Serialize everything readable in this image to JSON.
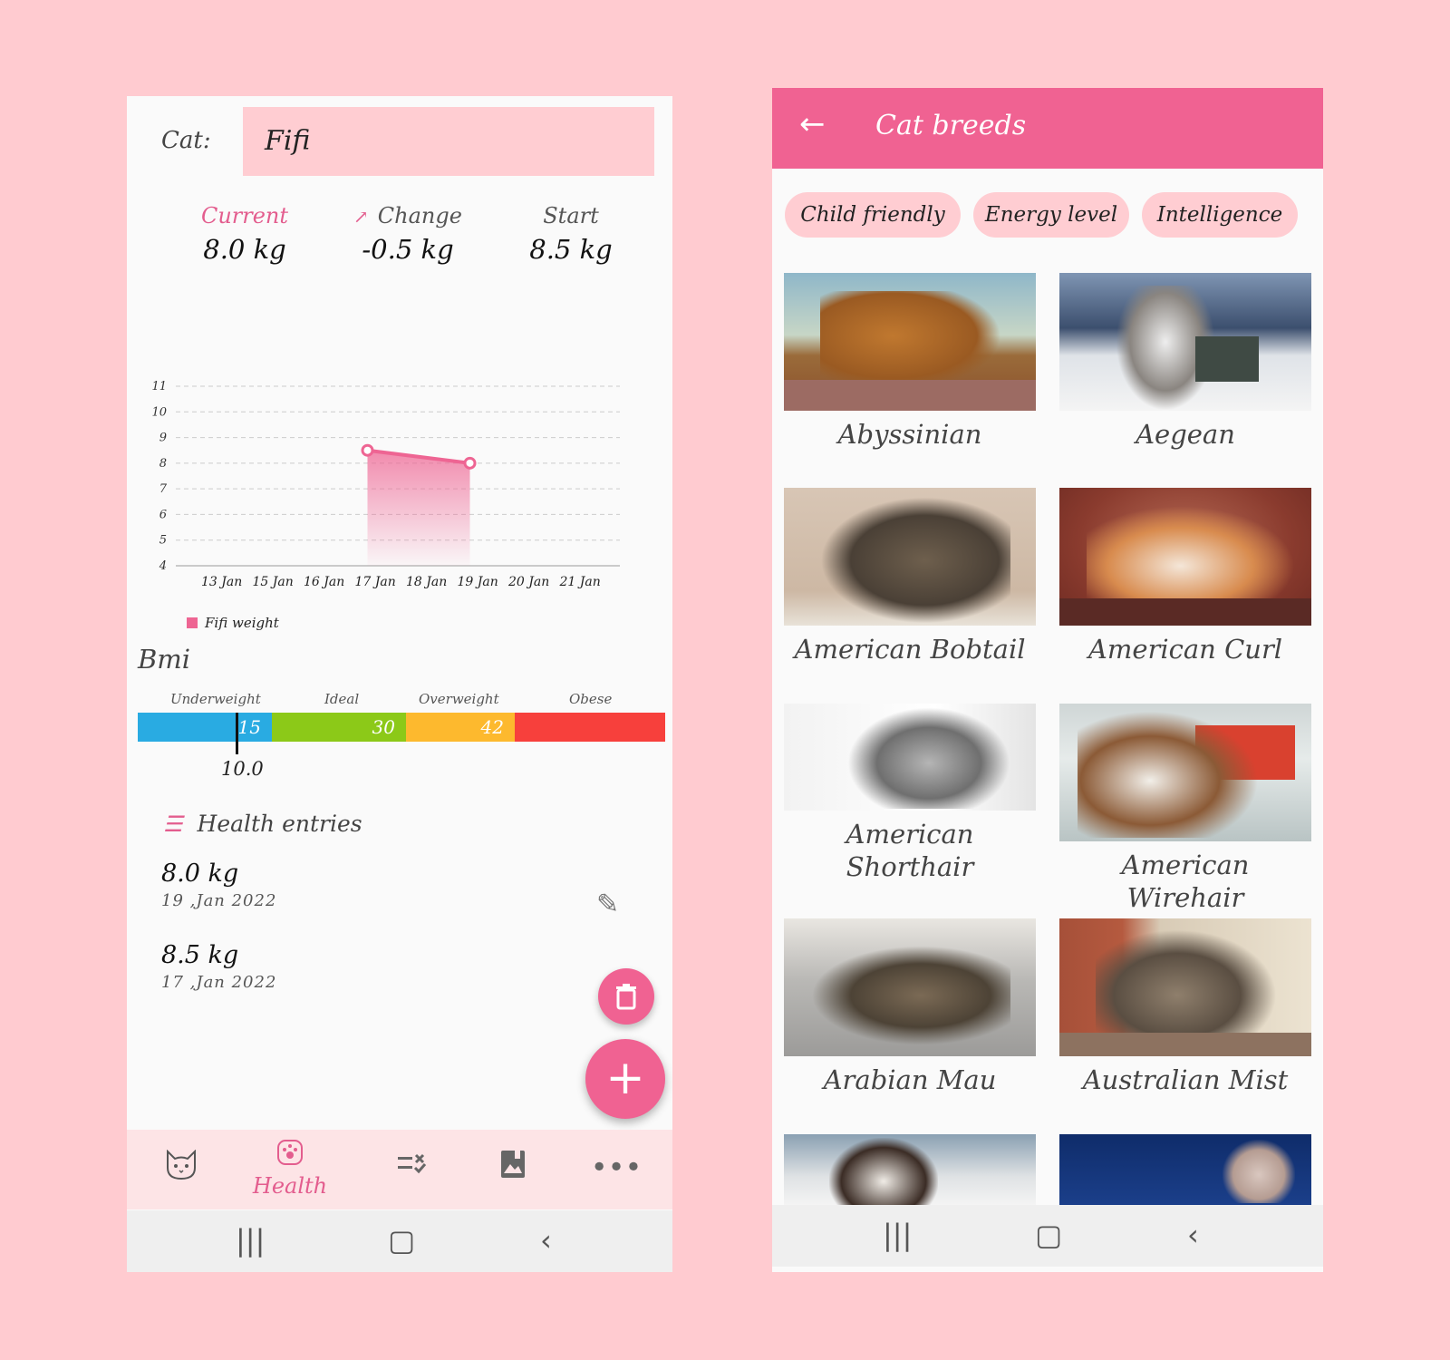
{
  "left": {
    "cat_label": "Cat:",
    "cat_name": "Fifi",
    "stats": [
      {
        "label": "Current",
        "value": "8.0 kg"
      },
      {
        "label": "Change",
        "value": "-0.5 kg"
      },
      {
        "label": "Start",
        "value": "8.5 kg"
      }
    ],
    "chart_data": {
      "type": "area",
      "y_ticks": [
        "11",
        "10",
        "9",
        "8",
        "7",
        "6",
        "5",
        "4"
      ],
      "ylim": [
        4,
        11
      ],
      "categories": [
        "13 Jan",
        "15 Jan",
        "16 Jan",
        "17 Jan",
        "18 Jan",
        "19 Jan",
        "20 Jan",
        "21 Jan"
      ],
      "series": [
        {
          "name": "Fifi weight",
          "points": [
            {
              "x": "17 Jan",
              "y": 8.5
            },
            {
              "x": "19 Jan",
              "y": 8.0
            }
          ]
        }
      ],
      "color": "#ee6593",
      "grid": true,
      "legend": "bottom-left"
    },
    "bmi": {
      "title": "Bmi",
      "categories": [
        "Underweight",
        "Ideal",
        "Overweight",
        "Obese"
      ],
      "thresholds": [
        "15",
        "30",
        "42"
      ],
      "colors": [
        "#29abe2",
        "#8cc918",
        "#fdb92e",
        "#f7403c"
      ],
      "current": "10.0"
    },
    "health_entries": {
      "title": "Health entries",
      "items": [
        {
          "weight": "8.0 kg",
          "date": "19 ,Jan 2022"
        },
        {
          "weight": "8.5 kg",
          "date": "17 ,Jan 2022"
        }
      ]
    },
    "nav": {
      "active_label": "Health"
    }
  },
  "right": {
    "title": "Cat breeds",
    "chips": [
      "Child friendly",
      "Energy level",
      "Intelligence"
    ],
    "breeds": [
      {
        "name": "Abyssinian"
      },
      {
        "name": "Aegean"
      },
      {
        "name": "American Bobtail"
      },
      {
        "name": "American Curl"
      },
      {
        "name": "American Shorthair"
      },
      {
        "name": "American Wirehair"
      },
      {
        "name": "Arabian Mau"
      },
      {
        "name": "Australian Mist"
      }
    ]
  }
}
